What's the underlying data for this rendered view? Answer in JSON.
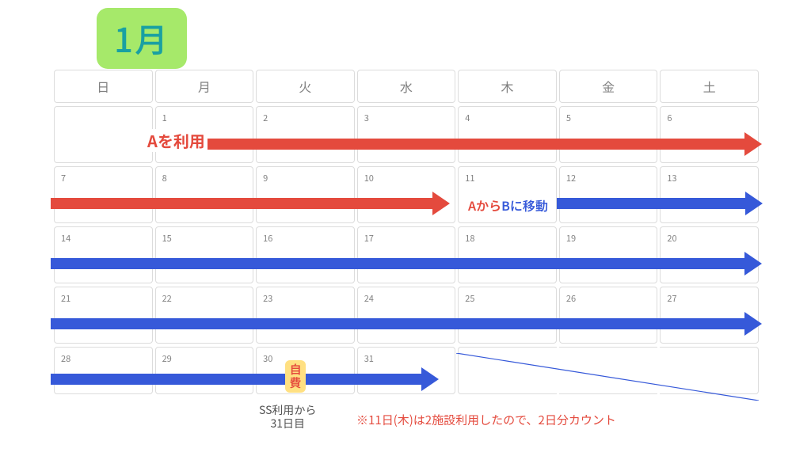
{
  "title": "1月",
  "weekdays": [
    "日",
    "月",
    "火",
    "水",
    "木",
    "金",
    "土"
  ],
  "weeks": [
    [
      "",
      "1",
      "2",
      "3",
      "4",
      "5",
      "6"
    ],
    [
      "7",
      "8",
      "9",
      "10",
      "11",
      "12",
      "13"
    ],
    [
      "14",
      "15",
      "16",
      "17",
      "18",
      "19",
      "20"
    ],
    [
      "21",
      "22",
      "23",
      "24",
      "25",
      "26",
      "27"
    ],
    [
      "28",
      "29",
      "30",
      "31",
      "",
      "",
      ""
    ]
  ],
  "labels": {
    "use_a": "Aを利用",
    "move_ab_a": "Aから",
    "move_ab_b": "Bに移動",
    "jihi": "自費",
    "ss_note_l1": "SS利用から",
    "ss_note_l2": "31日目",
    "footnote": "※11日(木)は2施設利用したので、2日分カウント"
  }
}
